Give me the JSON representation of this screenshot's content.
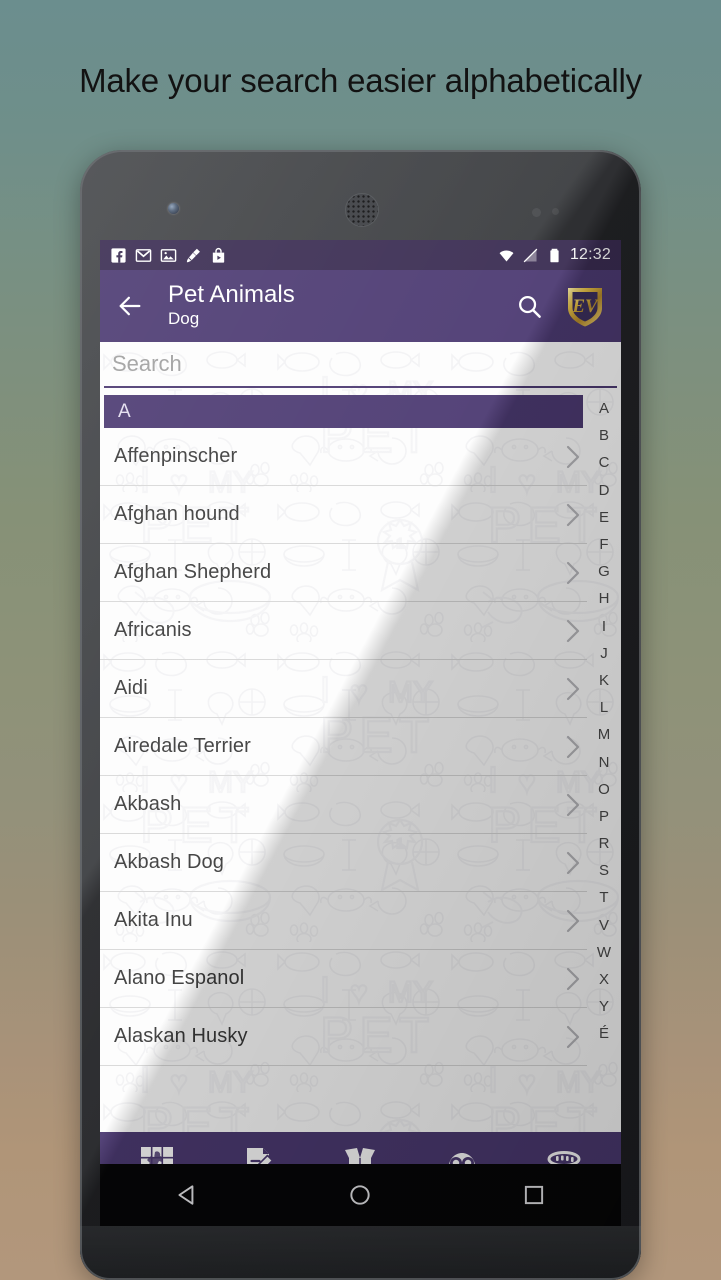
{
  "headline": "Make your search easier alphabetically",
  "status_bar": {
    "time": "12:32",
    "left_icons": [
      "facebook-icon",
      "gmail-icon",
      "photos-icon",
      "cleaner-icon",
      "play-store-icon"
    ],
    "right_icons": [
      "wifi-icon",
      "no-sim-icon",
      "battery-icon"
    ]
  },
  "app_bar": {
    "back_label": "back-arrow-icon",
    "title": "Pet Animals",
    "subtitle": "Dog",
    "search_label": "search-icon",
    "logo_text": "EV"
  },
  "search": {
    "value": "",
    "placeholder": "Search"
  },
  "section": {
    "header": "A"
  },
  "list": {
    "items": [
      {
        "label": "Affenpinscher"
      },
      {
        "label": "Afghan hound"
      },
      {
        "label": "Afghan Shepherd"
      },
      {
        "label": "Africanis"
      },
      {
        "label": "Aidi"
      },
      {
        "label": "Airedale Terrier"
      },
      {
        "label": "Akbash"
      },
      {
        "label": "Akbash Dog"
      },
      {
        "label": "Akita Inu"
      },
      {
        "label": "Alano Espanol"
      },
      {
        "label": "Alaskan Husky"
      }
    ]
  },
  "alpha_index": {
    "letters": [
      "A",
      "B",
      "C",
      "D",
      "E",
      "F",
      "G",
      "H",
      "I",
      "J",
      "K",
      "L",
      "M",
      "N",
      "O",
      "P",
      "R",
      "S",
      "T",
      "V",
      "W",
      "X",
      "Y",
      "É"
    ],
    "selected": "A"
  },
  "bottom_nav": {
    "items": [
      {
        "name": "puzzle-icon"
      },
      {
        "name": "quiz-icon"
      },
      {
        "name": "box-icon"
      },
      {
        "name": "owl-icon"
      },
      {
        "name": "collar-icon"
      }
    ]
  },
  "system_nav": {
    "items": [
      {
        "name": "android-back-icon"
      },
      {
        "name": "android-home-icon"
      },
      {
        "name": "android-recents-icon"
      }
    ]
  },
  "colors": {
    "primary_purple": "#4c3a72",
    "status_purple": "#3a2c52",
    "accent_gold": "#e8c349",
    "background_top": "#6b8e8e",
    "background_bottom": "#b2977c"
  }
}
